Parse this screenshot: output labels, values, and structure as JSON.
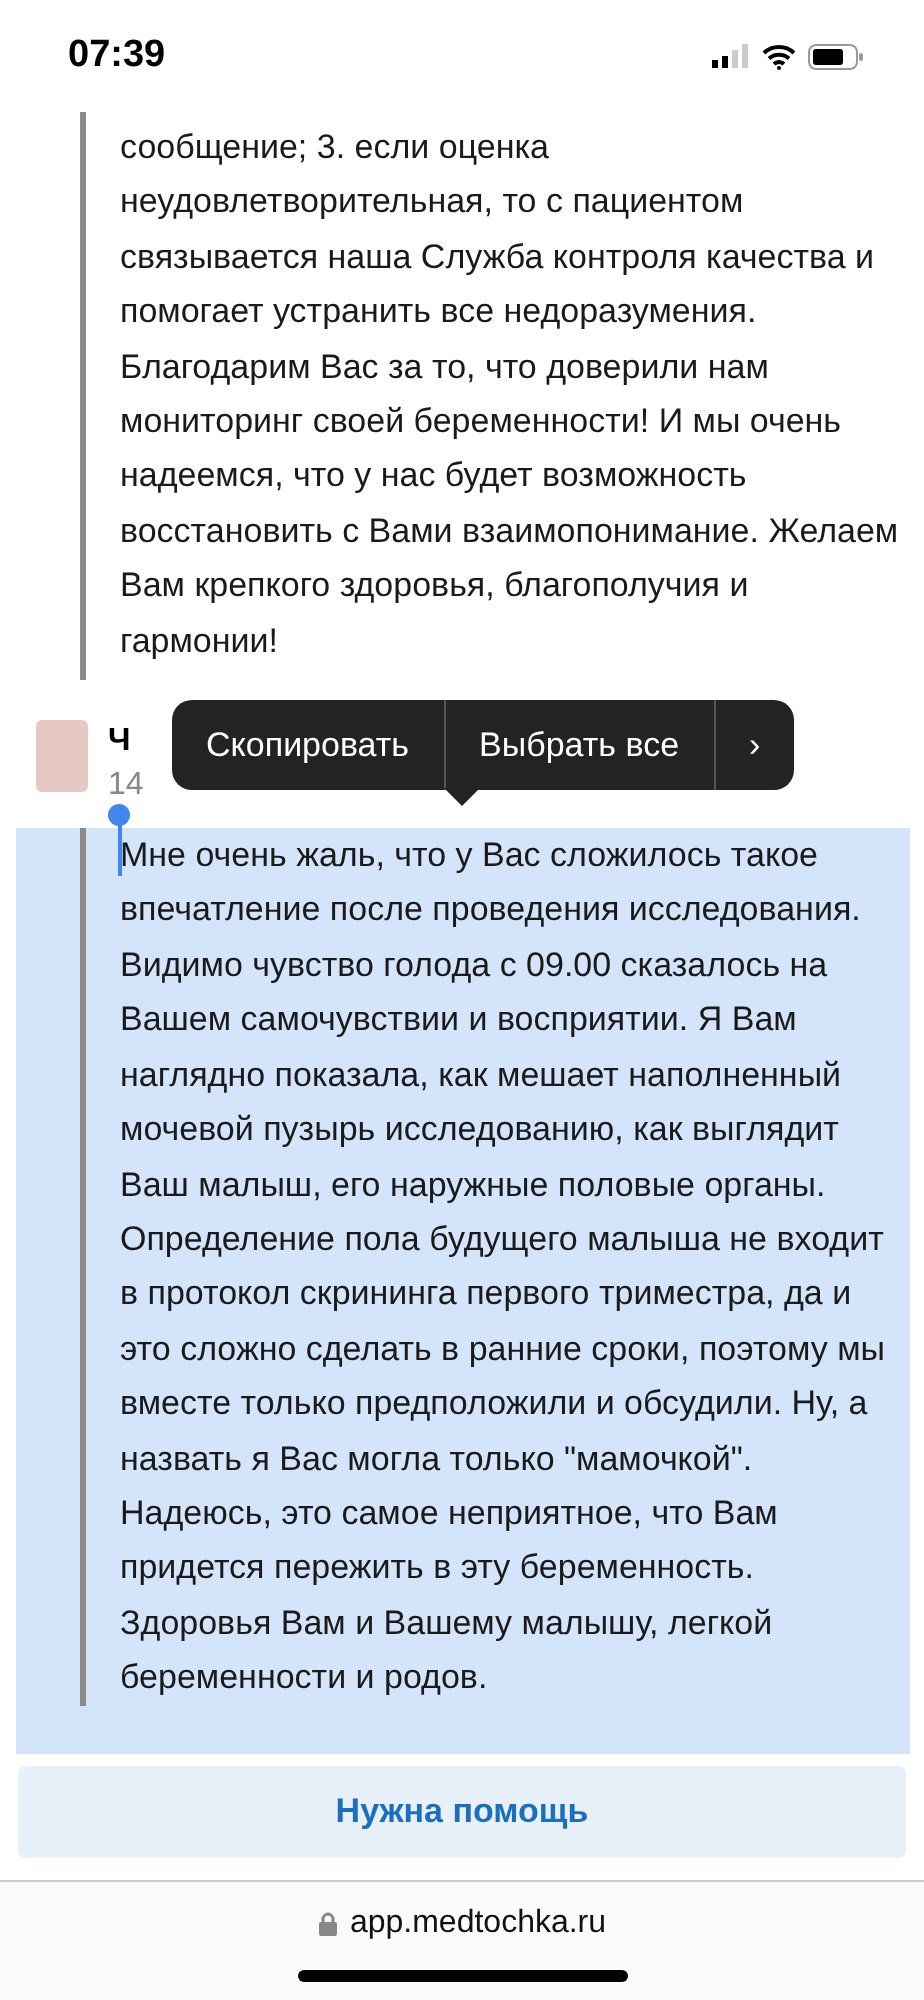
{
  "status_bar": {
    "time": "07:39"
  },
  "previous_reply": {
    "text": "сообщение;  3. если оценка неудовлетворительная, то с пациентом связывается наша Служба контроля качества и помогает устранить все недоразумения. Благодарим Вас за то, что доверили нам мониторинг своей беременности! И мы очень надеемся, что у нас будет возможность восстановить с Вами взаимопонимание. Желаем Вам крепкого здоровья, благополучия и гармонии!"
  },
  "comment": {
    "author": "Ч",
    "date": "14",
    "text": "Мне очень жаль, что у Вас сложилось такое впечатление после проведения исследования.   Видимо чувство голода с 09.00 сказалось на Вашем самочувствии и восприятии.  Я Вам наглядно показала, как мешает наполненный мочевой пузырь исследованию, как выглядит Ваш малыш, его наружные половые органы. Определение пола будущего малыша не входит в протокол скрининга первого триместра, да и это сложно сделать в ранние сроки, поэтому мы вместе только предположили и обсудили.  Ну, а назвать я Вас могла только \"мамочкой\". Надеюсь, это самое неприятное, что Вам придется пережить в эту беременность. Здоровья Вам и Вашему малышу, легкой беременности и родов.",
    "selected": true
  },
  "context_menu": {
    "items": [
      "Скопировать",
      "Выбрать все",
      "›"
    ]
  },
  "help_button": {
    "label": "Нужна помощь"
  },
  "address_bar": {
    "url": "app.medtochka.ru"
  }
}
